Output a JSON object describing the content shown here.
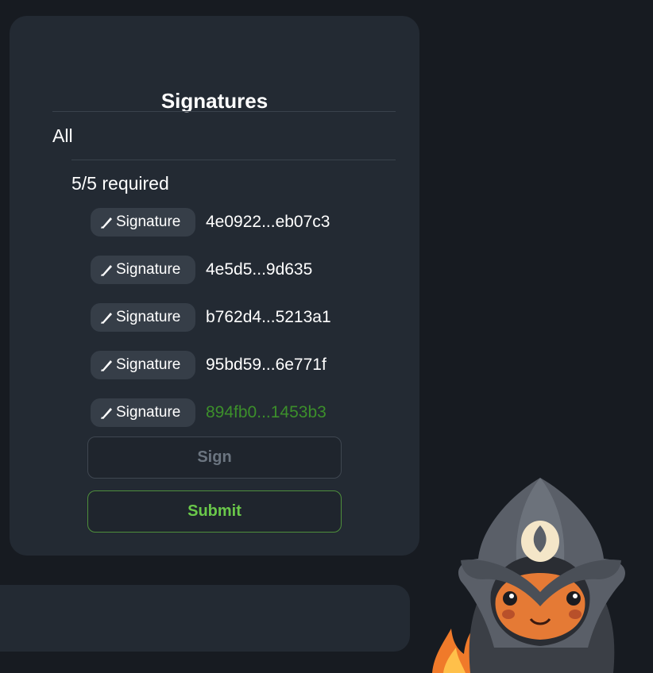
{
  "panel": {
    "title": "Signatures",
    "group_label": "All",
    "required_label": "5/5 required",
    "signatures": [
      {
        "label": "Signature",
        "key": "4e0922...eb07c3",
        "status": "default"
      },
      {
        "label": "Signature",
        "key": "4e5d5...9d635",
        "status": "default"
      },
      {
        "label": "Signature",
        "key": "b762d4...5213a1",
        "status": "default"
      },
      {
        "label": "Signature",
        "key": "95bd59...6e771f",
        "status": "default"
      },
      {
        "label": "Signature",
        "key": "894fb0...1453b3",
        "status": "signed"
      }
    ],
    "sign_button": "Sign",
    "submit_button": "Submit"
  },
  "colors": {
    "background": "#171b21",
    "card": "#232a33",
    "chip": "#363e48",
    "signed_key": "#3c8f2b",
    "submit_accent": "#6ac84a",
    "disabled_text": "#6b7580"
  },
  "icons": [
    "pen-icon",
    "mascot-image"
  ]
}
